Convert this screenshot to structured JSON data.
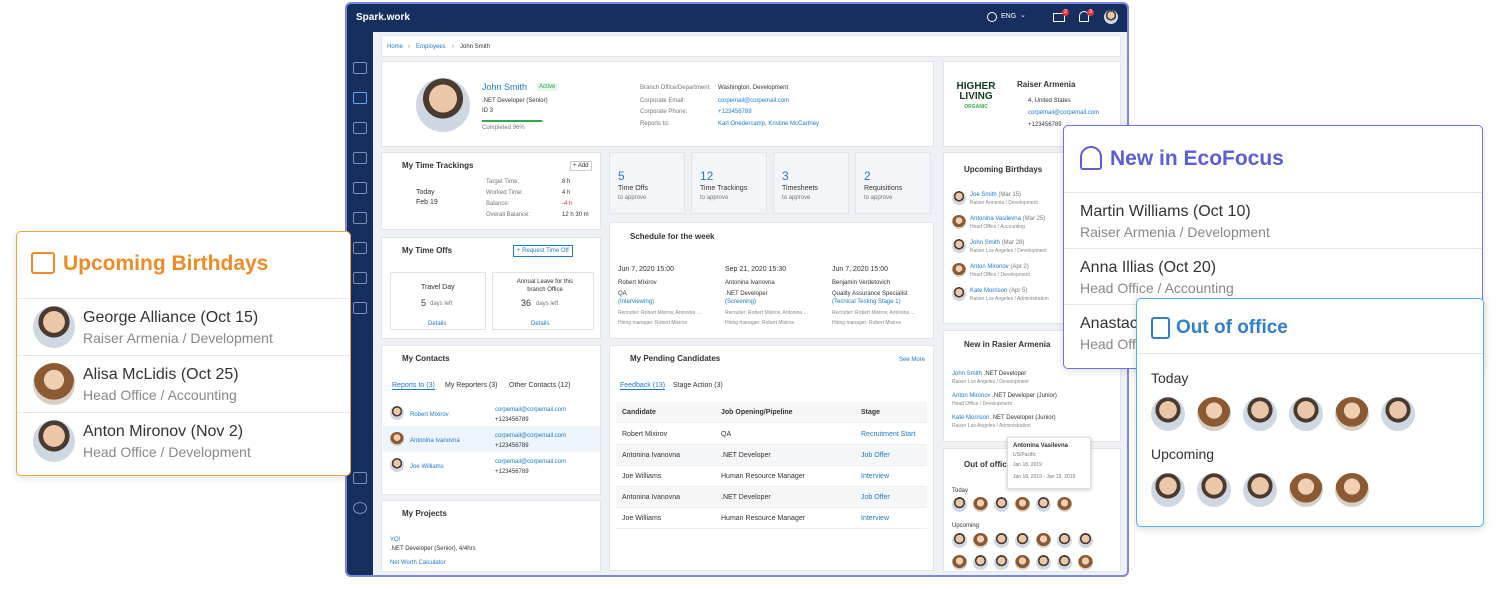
{
  "app": {
    "logo": "Spark.work",
    "lang": "ENG",
    "mail_badge": "2",
    "bell_badge": "3"
  },
  "breadcrumb": {
    "home": "Home",
    "employees": "Employees",
    "current": "John Smith"
  },
  "profile": {
    "name": "John Smith",
    "status": "Active",
    "role": ".NET Developer (Senior)",
    "id": "ID 3",
    "completed": "Completed 96%",
    "completed_fraction": 0.96,
    "fields": [
      {
        "label": "Branch Office/Department:",
        "value": "Washington, Development"
      },
      {
        "label": "Corporate Email:",
        "value": "corpemail@corpemail.com"
      },
      {
        "label": "Corporate Phone:",
        "value": "+123456789"
      },
      {
        "label": "Reports to:",
        "value": "Karl Onedercamp, Kristine McCartney"
      }
    ]
  },
  "company": {
    "name": "Raiser Armenia",
    "logo_line1": "HIGHER",
    "logo_line2": "LIVING",
    "logo_line3": "ORGANIC",
    "address": "4, United States",
    "email": "corpemail@corpemail.com",
    "phone": "+123456789"
  },
  "time_tracking": {
    "title": "My Time Trackings",
    "add": "+ Add",
    "today": "Today",
    "date": "Feb 19",
    "rows": [
      {
        "label": "Target Time:",
        "value": "8 h"
      },
      {
        "label": "Worked Time:",
        "value": "4 h"
      },
      {
        "label": "Balance:",
        "value": "-4 h"
      },
      {
        "label": "Overall Balance:",
        "value": "12 h 30 m"
      }
    ]
  },
  "stats": [
    {
      "num": "5",
      "label": "Time Offs",
      "sub": "to approve"
    },
    {
      "num": "12",
      "label": "Time Trackings",
      "sub": "to approve"
    },
    {
      "num": "3",
      "label": "Timesheets",
      "sub": "to approve"
    },
    {
      "num": "2",
      "label": "Requisitions",
      "sub": "to approve"
    }
  ],
  "time_offs": {
    "title": "My Time Offs",
    "request": "+ Request Time Off",
    "items": [
      {
        "name": "Travel Day",
        "days": "5",
        "unit": "days left",
        "details": "Details"
      },
      {
        "name": "Annual Leave for this branch Office",
        "days": "36",
        "unit": "days left",
        "details": "Details"
      }
    ]
  },
  "schedule": {
    "title": "Schedule for the week",
    "items": [
      {
        "date": "Jun 7, 2020 15:00",
        "name": "Robert Mixirov",
        "role": "QA",
        "stage": "(Interviewing)",
        "recruiter": "Recruiter: Robert Mixirov, Antonina ...",
        "hm": "Hiring manager: Robert Mixirov"
      },
      {
        "date": "Sep 21, 2020 15:30",
        "name": "Antonina Ivanovna",
        "role": ".NET Developer",
        "stage": "(Screening)",
        "recruiter": "Recruiter: Robert Mixirov, Antonina ...",
        "hm": "Hiring manager: Robert Mixirov"
      },
      {
        "date": "Jun 7, 2020 15:00",
        "name": "Benjamin Verdetovich",
        "role": "Quality Assurance Specialist",
        "stage": "(Tecnical Testing Stage 1)",
        "recruiter": "Recruiter: Robert Mixirov, Antonina ...",
        "hm": "Hiring manager: Robert Mixirov"
      }
    ]
  },
  "contacts": {
    "title": "My Contacts",
    "tabs": [
      "Reports to (3)",
      "My Reporters (3)",
      "Other Contacts (12)"
    ],
    "items": [
      {
        "name": "Robert Mixirov",
        "email": "corpemail@corpemail.com",
        "phone": "+123456789"
      },
      {
        "name": "Antonina Ivanovna",
        "email": "corpemail@corpemail.com",
        "phone": "+123456789"
      },
      {
        "name": "Joe Williams",
        "email": "corpemail@corpemail.com",
        "phone": "+123456789"
      }
    ]
  },
  "candidates": {
    "title": "My Pending Candidates",
    "more": "See More",
    "tabs": [
      "Feedback (13)",
      "Stage Action (3)"
    ],
    "headers": [
      "Candidate",
      "Job Opening/Pipeline",
      "Stage"
    ],
    "rows": [
      [
        "Robert Mixirov",
        "QA",
        "Recruitment Start"
      ],
      [
        "Antonina Ivanovna",
        ".NET Developer",
        "Job Offer"
      ],
      [
        "Joe Williams",
        "Human Resource Manager",
        "Interview"
      ],
      [
        "Antonina Ivanovna",
        ".NET Developer",
        "Job Offer"
      ],
      [
        "Joe Williams",
        "Human Resource Manager",
        "Interview"
      ]
    ]
  },
  "projects": {
    "title": "My Projects",
    "items": [
      {
        "name": "YO!",
        "role": ".NET Developer (Senior), 4/4hrs"
      },
      {
        "name": "Net Worth Calculator",
        "role": ""
      }
    ]
  },
  "upcoming_small": {
    "title": "Upcoming Birthdays",
    "items": [
      {
        "name": "Joe Smith",
        "date": "(Mar 15)",
        "sub": "Raiser Armenia / Development"
      },
      {
        "name": "Antonina Vasilevna",
        "date": "(Mar 25)",
        "sub": "Head Office / Accounting"
      },
      {
        "name": "John Smith",
        "date": "(Mar 28)",
        "sub": "Raiser Los Angeles / Development"
      },
      {
        "name": "Anton Mironov",
        "date": "(Apr 2)",
        "sub": "Head Office / Development"
      },
      {
        "name": "Kate Morrison",
        "date": "(Apr 5)",
        "sub": "Raiser Los Angeles / Administration"
      }
    ]
  },
  "new_small": {
    "title": "New in Rasier Armenia",
    "items": [
      {
        "name": "John Smith",
        "role": ".NET Developer",
        "sub": "Raiser Los Angeles / Development"
      },
      {
        "name": "Anton Mironov",
        "role": ".NET Developer (Junior)",
        "sub": "Head Office / Development"
      },
      {
        "name": "Kate Morrison",
        "role": ".NET Developer (Junior)",
        "sub": "Raiser Los Angeles / Administration"
      }
    ]
  },
  "ooo_small": {
    "title": "Out of office",
    "today": "Today",
    "upcoming": "Upcoming"
  },
  "tooltip": {
    "name": "Antonina Vasilevna",
    "region": "US/Pacific",
    "date": "Jan 18, 2019",
    "range": "Jan 18, 2019 - Jan 19, 2019"
  },
  "big_birthdays": {
    "title": "Upcoming Birthdays",
    "items": [
      {
        "name": "George Alliance",
        "date": "(Oct 15)",
        "sub": "Raiser Armenia / Development"
      },
      {
        "name": "Alisa McLidis",
        "date": "(Oct 25)",
        "sub": "Head Office / Accounting"
      },
      {
        "name": "Anton Mironov",
        "date": "(Nov 2)",
        "sub": "Head Office / Development"
      }
    ]
  },
  "big_new": {
    "title": "New in EcoFocus",
    "items": [
      {
        "name": "Martin Williams",
        "date": "(Oct 10)",
        "sub": "Raiser Armenia / Development"
      },
      {
        "name": "Anna Illias",
        "date": "(Oct 20)",
        "sub": "Head Office / Accounting"
      },
      {
        "name": "Anastac",
        "date": "",
        "sub": "Head Off"
      }
    ]
  },
  "big_ooo": {
    "title": "Out of office",
    "today": "Today",
    "upcoming": "Upcoming"
  },
  "colors": {
    "navy": "#162f5e",
    "orange": "#f08a24",
    "purple": "#5a5fd6",
    "blue": "#2f7fd0",
    "green": "#2fa84f"
  }
}
